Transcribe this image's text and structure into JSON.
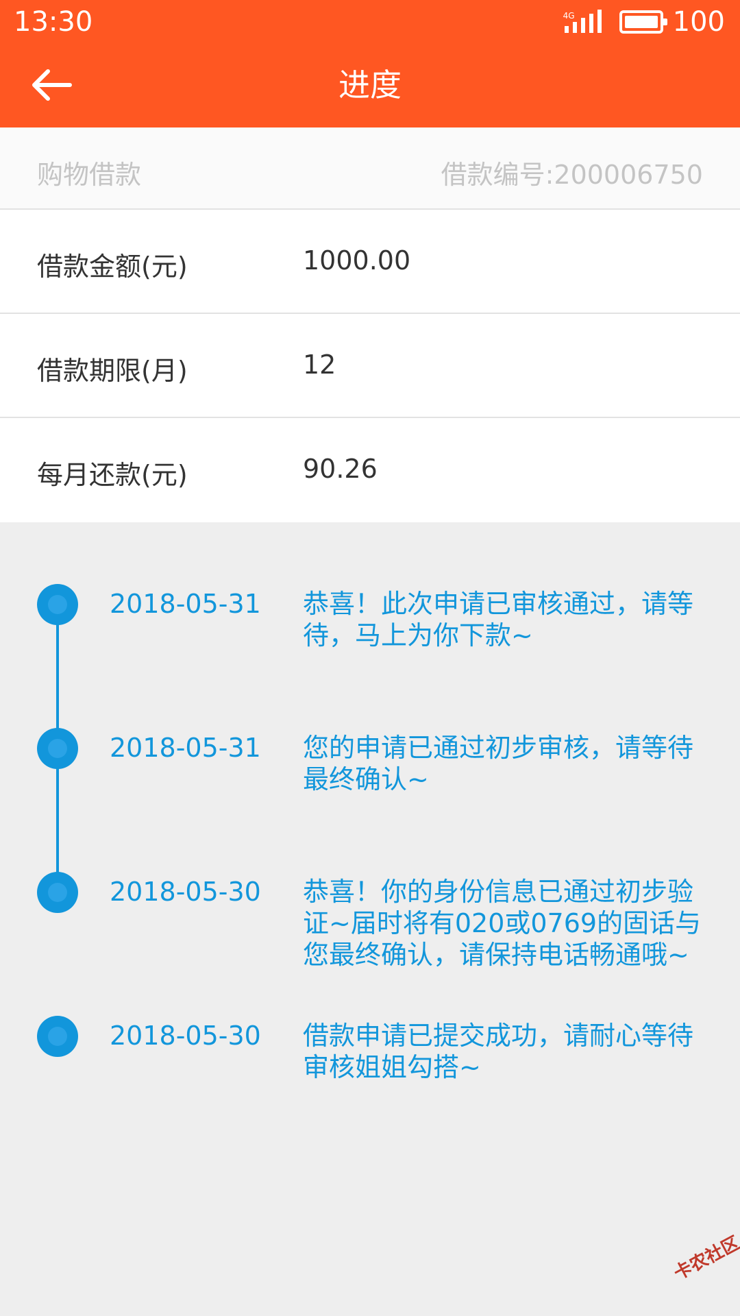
{
  "status_bar": {
    "time": "13:30",
    "network": "4G",
    "battery": "100"
  },
  "nav": {
    "title": "进度",
    "back_icon": "arrow-left-icon"
  },
  "subheader": {
    "type": "购物借款",
    "loan_number": "借款编号:200006750"
  },
  "info_rows": [
    {
      "label": "借款金额(元)",
      "value": "1000.00"
    },
    {
      "label": "借款期限(月)",
      "value": "12"
    },
    {
      "label": "每月还款(元)",
      "value": "90.26"
    }
  ],
  "timeline": [
    {
      "date": "2018-05-31",
      "text": "恭喜！此次申请已审核通过，请等待，马上为你下款~"
    },
    {
      "date": "2018-05-31",
      "text": "您的申请已通过初步审核，请等待最终确认~"
    },
    {
      "date": "2018-05-30",
      "text": "恭喜！你的身份信息已通过初步验证~届时将有020或0769的固话与您最终确认，请保持电话畅通哦~"
    },
    {
      "date": "2018-05-30",
      "text": "借款申请已提交成功，请耐心等待审核姐姐勾搭~"
    }
  ],
  "watermark": "卡农社区",
  "colors": {
    "header": "#ff5722",
    "accent": "#1296db",
    "background": "#eeeeee"
  }
}
